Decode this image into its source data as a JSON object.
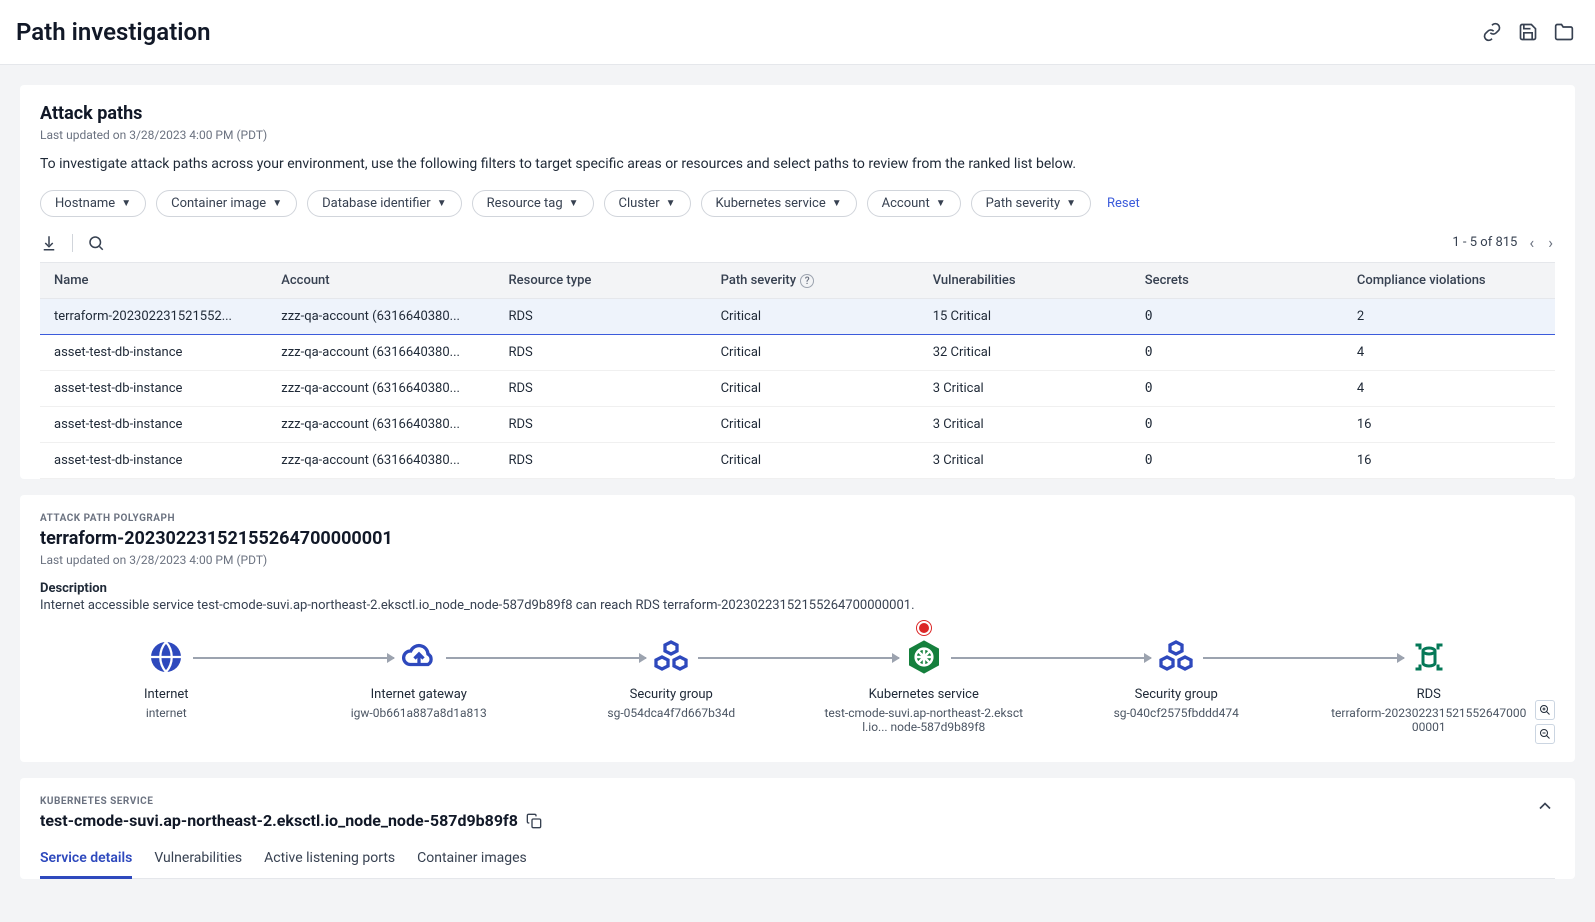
{
  "header": {
    "title": "Path investigation"
  },
  "attack_paths": {
    "title": "Attack paths",
    "last_updated": "Last updated on 3/28/2023 4:00 PM (PDT)",
    "description": "To investigate attack paths across your environment, use the following filters to target specific areas or resources and select paths to review from the ranked list below.",
    "filters": [
      "Hostname",
      "Container image",
      "Database identifier",
      "Resource tag",
      "Cluster",
      "Kubernetes service",
      "Account",
      "Path severity"
    ],
    "reset": "Reset",
    "pager": "1 - 5 of 815",
    "columns": [
      "Name",
      "Account",
      "Resource type",
      "Path severity",
      "Vulnerabilities",
      "Secrets",
      "Compliance violations"
    ],
    "rows": [
      {
        "name": "terraform-202302231521552...",
        "account": "zzz-qa-account (6316640380...",
        "rtype": "RDS",
        "severity": "Critical",
        "vulns": "15 Critical",
        "secrets": "0",
        "compliance": "2",
        "selected": true
      },
      {
        "name": "asset-test-db-instance",
        "account": "zzz-qa-account (6316640380...",
        "rtype": "RDS",
        "severity": "Critical",
        "vulns": "32 Critical",
        "secrets": "0",
        "compliance": "4"
      },
      {
        "name": "asset-test-db-instance",
        "account": "zzz-qa-account (6316640380...",
        "rtype": "RDS",
        "severity": "Critical",
        "vulns": "3 Critical",
        "secrets": "0",
        "compliance": "4"
      },
      {
        "name": "asset-test-db-instance",
        "account": "zzz-qa-account (6316640380...",
        "rtype": "RDS",
        "severity": "Critical",
        "vulns": "3 Critical",
        "secrets": "0",
        "compliance": "16"
      },
      {
        "name": "asset-test-db-instance",
        "account": "zzz-qa-account (6316640380...",
        "rtype": "RDS",
        "severity": "Critical",
        "vulns": "3 Critical",
        "secrets": "0",
        "compliance": "16"
      }
    ]
  },
  "polygraph": {
    "label": "ATTACK PATH POLYGRAPH",
    "title": "terraform-20230223152155264700000001",
    "last_updated": "Last updated on 3/28/2023 4:00 PM (PDT)",
    "desc_heading": "Description",
    "description": "Internet accessible service test-cmode-suvi.ap-northeast-2.eksctl.io_node_node-587d9b89f8 can reach RDS terraform-20230223152155264700000001.",
    "nodes": [
      {
        "title": "Internet",
        "sub": "internet",
        "icon": "globe"
      },
      {
        "title": "Internet gateway",
        "sub": "igw-0b661a887a8d1a813",
        "icon": "igw"
      },
      {
        "title": "Security group",
        "sub": "sg-054dca4f7d667b34d",
        "icon": "sg"
      },
      {
        "title": "Kubernetes service",
        "sub": "test-cmode-suvi.ap-northeast-2.eksctl.io... node-587d9b89f8",
        "icon": "k8s",
        "badge": true
      },
      {
        "title": "Security group",
        "sub": "sg-040cf2575fbddd474",
        "icon": "sg"
      },
      {
        "title": "RDS",
        "sub": "terraform-20230223152155264700000001",
        "icon": "rds"
      }
    ]
  },
  "service": {
    "label": "KUBERNETES SERVICE",
    "title": "test-cmode-suvi.ap-northeast-2.eksctl.io_node_node-587d9b89f8",
    "tabs": [
      "Service details",
      "Vulnerabilities",
      "Active listening ports",
      "Container images"
    ],
    "active_tab": 0
  }
}
